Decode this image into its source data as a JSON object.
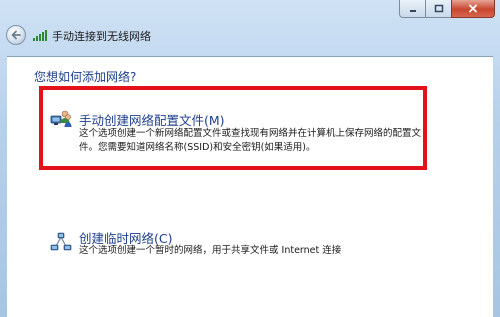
{
  "window": {
    "title": "手动连接到无线网络",
    "controls": {
      "minimize_icon": "minimize-icon",
      "maximize_icon": "maximize-icon",
      "close_icon": "close-icon"
    }
  },
  "main": {
    "question": "您想如何添加网络?",
    "options": [
      {
        "title": "手动创建网络配置文件(M)",
        "description": [
          "这个选项创建一个新网络配置文件或查找现有网络并在计算机上保存网络的配置文",
          "件。您需要知道网络名称(SSID)和安全密钥(如果适用)。"
        ],
        "icon": "network-users-icon"
      },
      {
        "title": "创建临时网络(C)",
        "description": [
          "这个选项创建一个暂时的网络，用于共享文件或 Internet 连接"
        ],
        "icon": "adhoc-network-icon"
      }
    ]
  },
  "colors": {
    "accent_text": "#1e3f8f",
    "highlight_border": "#e4121a",
    "frame": "#b6d0ea"
  }
}
